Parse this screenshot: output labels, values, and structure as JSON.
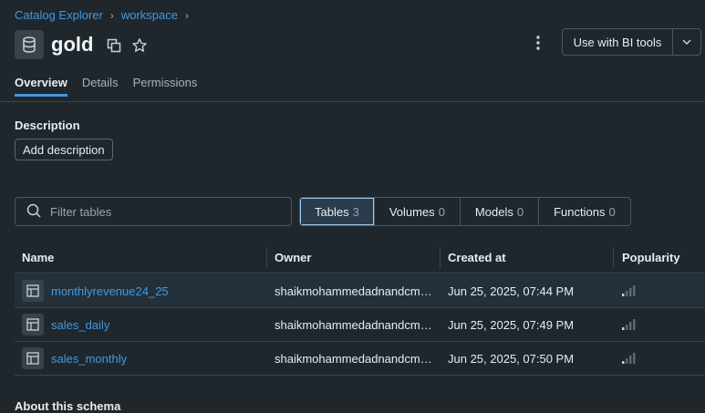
{
  "breadcrumb": [
    "Catalog Explorer",
    "workspace"
  ],
  "schema": {
    "name": "gold",
    "icon": "database-icon"
  },
  "header": {
    "bi_button_label": "Use with BI tools"
  },
  "tabs": [
    {
      "label": "Overview",
      "active": true
    },
    {
      "label": "Details",
      "active": false
    },
    {
      "label": "Permissions",
      "active": false
    }
  ],
  "description": {
    "label": "Description",
    "button": "Add description"
  },
  "filter": {
    "placeholder": "Filter tables"
  },
  "segments": [
    {
      "label": "Tables",
      "count": "3",
      "active": true
    },
    {
      "label": "Volumes",
      "count": "0",
      "active": false
    },
    {
      "label": "Models",
      "count": "0",
      "active": false
    },
    {
      "label": "Functions",
      "count": "0",
      "active": false
    }
  ],
  "table": {
    "columns": [
      "Name",
      "Owner",
      "Created at",
      "Popularity"
    ],
    "rows": [
      {
        "name": "monthlyrevenue24_25",
        "owner": "shaikmohammedadnandcm…",
        "created": "Jun 25, 2025, 07:44 PM",
        "popularity_level": 1
      },
      {
        "name": "sales_daily",
        "owner": "shaikmohammedadnandcm…",
        "created": "Jun 25, 2025, 07:49 PM",
        "popularity_level": 1
      },
      {
        "name": "sales_monthly",
        "owner": "shaikmohammedadnandcm…",
        "created": "Jun 25, 2025, 07:50 PM",
        "popularity_level": 1
      }
    ]
  },
  "about": {
    "heading": "About this schema"
  },
  "colors": {
    "accent": "#4299e0",
    "background": "#1f272d",
    "active_segment": "#2a3d4d"
  }
}
